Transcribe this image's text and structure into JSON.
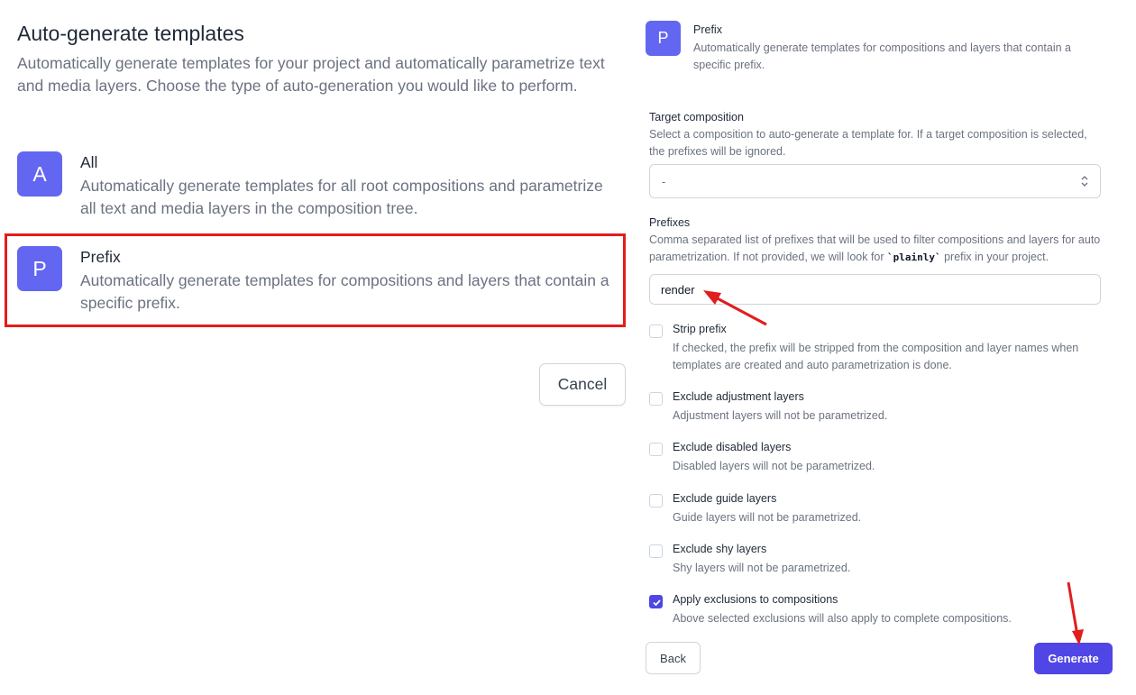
{
  "header": {
    "title": "Auto-generate templates",
    "description": "Automatically generate templates for your project and automatically parametrize text and media layers. Choose the type of auto-generation you would like to perform."
  },
  "options": [
    {
      "letter": "A",
      "title": "All",
      "description": "Automatically generate templates for all root compositions and parametrize all text and media layers in the composition tree."
    },
    {
      "letter": "P",
      "title": "Prefix",
      "description": "Automatically generate templates for compositions and layers that contain a specific prefix."
    }
  ],
  "cancel_label": "Cancel",
  "selected": {
    "letter": "P",
    "title": "Prefix",
    "description": "Automatically generate templates for compositions and layers that contain a specific prefix."
  },
  "target_composition": {
    "label": "Target composition",
    "help": "Select a composition to auto-generate a template for. If a target composition is selected, the prefixes will be ignored.",
    "value": "-"
  },
  "prefixes": {
    "label": "Prefixes",
    "help_before": "Comma separated list of prefixes that will be used to filter compositions and layers for auto parametrization. If not provided, we will look for ",
    "help_code": "`plainly`",
    "help_after": " prefix in your project.",
    "value": "render"
  },
  "checks": [
    {
      "title": "Strip prefix",
      "description": "If checked, the prefix will be stripped from the composition and layer names when templates are created and auto parametrization is done.",
      "checked": false
    },
    {
      "title": "Exclude adjustment layers",
      "description": "Adjustment layers will not be parametrized.",
      "checked": false
    },
    {
      "title": "Exclude disabled layers",
      "description": "Disabled layers will not be parametrized.",
      "checked": false
    },
    {
      "title": "Exclude guide layers",
      "description": "Guide layers will not be parametrized.",
      "checked": false
    },
    {
      "title": "Exclude shy layers",
      "description": "Shy layers will not be parametrized.",
      "checked": false
    },
    {
      "title": "Apply exclusions to compositions",
      "description": "Above selected exclusions will also apply to complete compositions.",
      "checked": true
    }
  ],
  "buttons": {
    "back": "Back",
    "generate": "Generate"
  },
  "colors": {
    "accent": "#4f46e5",
    "badge": "#6366f1",
    "annotation": "#e11d1d"
  }
}
